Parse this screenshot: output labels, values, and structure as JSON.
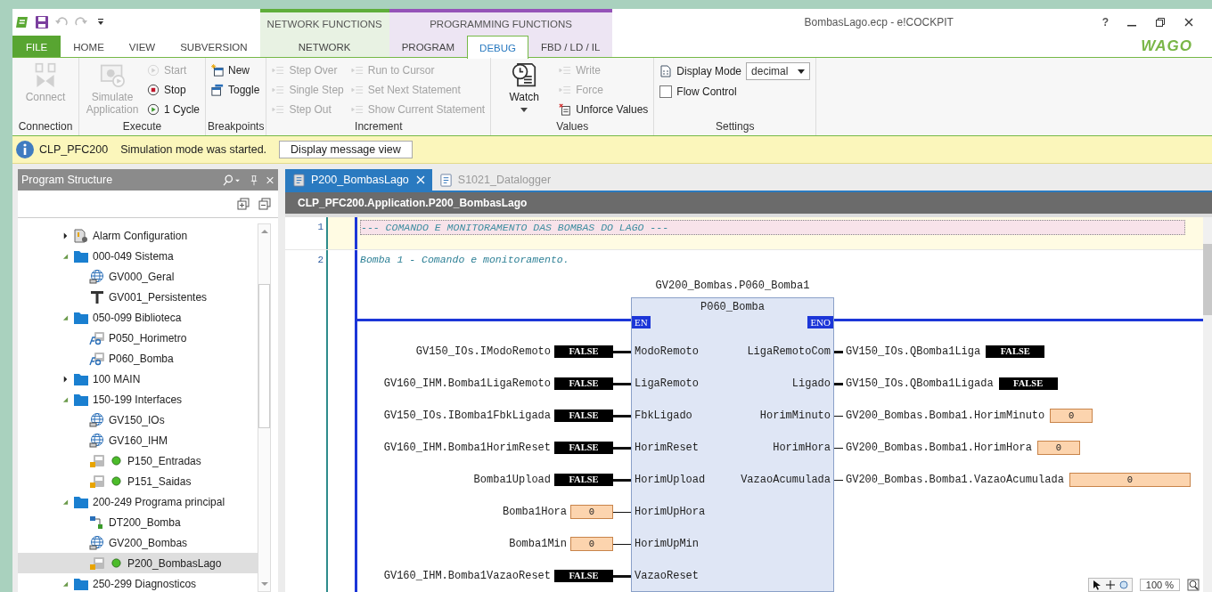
{
  "app": {
    "title": "BombasLago.ecp - e!COCKPIT",
    "help": "?",
    "logo": "WAGO"
  },
  "tabs": [
    {
      "label": "FILE",
      "kind": "file",
      "selected": false
    },
    {
      "label": "HOME",
      "kind": "tab",
      "selected": false
    },
    {
      "label": "VIEW",
      "kind": "tab",
      "selected": false
    },
    {
      "label": "SUBVERSION",
      "kind": "tab",
      "selected": false
    }
  ],
  "context_groups": [
    {
      "label": "NETWORK FUNCTIONS",
      "kind": "network",
      "tabs": [
        {
          "label": "NETWORK",
          "selected": false
        }
      ]
    },
    {
      "label": "PROGRAMMING FUNCTIONS",
      "kind": "programming",
      "tabs": [
        {
          "label": "PROGRAM",
          "selected": false
        },
        {
          "label": "DEBUG",
          "selected": true
        },
        {
          "label": "FBD / LD / IL",
          "selected": false
        }
      ]
    }
  ],
  "ribbon": [
    {
      "label": "Connection",
      "columns": [
        {
          "kind": "large",
          "items": [
            {
              "label": "Connect",
              "kind": "connect",
              "disabled": true
            }
          ]
        }
      ]
    },
    {
      "label": "Execute",
      "columns": [
        {
          "kind": "large",
          "items": [
            {
              "label": "Simulate Application",
              "kind": "simulate",
              "disabled": true
            }
          ]
        },
        {
          "kind": "small",
          "items": [
            {
              "label": "Start",
              "kind": "start",
              "disabled": true
            },
            {
              "label": "Stop",
              "kind": "stop",
              "disabled": false
            },
            {
              "label": "1 Cycle",
              "kind": "cycle",
              "disabled": false
            }
          ]
        }
      ]
    },
    {
      "label": "Breakpoints",
      "columns": [
        {
          "kind": "small",
          "items": [
            {
              "label": "New",
              "kind": "new",
              "disabled": false
            },
            {
              "label": "Toggle",
              "kind": "toggle",
              "disabled": false
            }
          ]
        }
      ]
    },
    {
      "label": "Increment",
      "columns": [
        {
          "kind": "small",
          "items": [
            {
              "label": "Step Over",
              "kind": "step",
              "disabled": true
            },
            {
              "label": "Single Step",
              "kind": "step",
              "disabled": true
            },
            {
              "label": "Step Out",
              "kind": "step",
              "disabled": true
            }
          ]
        },
        {
          "kind": "small",
          "items": [
            {
              "label": "Run to Cursor",
              "kind": "cursor",
              "disabled": true
            },
            {
              "label": "Set Next Statement",
              "kind": "next",
              "disabled": true
            },
            {
              "label": "Show Current Statement",
              "kind": "arrow",
              "disabled": true
            }
          ]
        }
      ]
    },
    {
      "label": "Values",
      "columns": [
        {
          "kind": "large",
          "items": [
            {
              "label": "Watch",
              "kind": "watch",
              "disabled": false,
              "dropdown": true
            }
          ]
        },
        {
          "kind": "small",
          "items": [
            {
              "label": "Write",
              "kind": "write",
              "disabled": true
            },
            {
              "label": "Force",
              "kind": "force",
              "disabled": true
            },
            {
              "label": "Unforce Values",
              "kind": "unforce",
              "disabled": false
            }
          ]
        }
      ]
    },
    {
      "label": "Settings",
      "columns": [
        {
          "kind": "small",
          "items": [
            {
              "label": "Display Mode",
              "kind": "select",
              "value": "decimal"
            },
            {
              "label": "Flow Control",
              "kind": "checkbox",
              "checked": false
            }
          ]
        }
      ]
    }
  ],
  "message": {
    "source": "CLP_PFC200",
    "text": "Simulation mode was started.",
    "button": "Display message view"
  },
  "program_structure": {
    "title": "Program Structure",
    "tree": [
      {
        "label": "Alarm Configuration",
        "kind": "alarm",
        "expanded": false,
        "selected": false
      },
      {
        "label": "000-049 Sistema",
        "kind": "folder",
        "expanded": true,
        "selected": false,
        "children": [
          {
            "label": "GV000_Geral",
            "kind": "gvl",
            "selected": false
          },
          {
            "label": "GV001_Persistentes",
            "kind": "persistent",
            "selected": false
          }
        ]
      },
      {
        "label": "050-099 Biblioteca",
        "kind": "folder",
        "expanded": true,
        "selected": false,
        "children": [
          {
            "label": "P050_Horimetro",
            "kind": "fb",
            "selected": false
          },
          {
            "label": "P060_Bomba",
            "kind": "fb",
            "selected": false
          }
        ]
      },
      {
        "label": "100 MAIN",
        "kind": "folder",
        "expanded": false,
        "selected": false
      },
      {
        "label": "150-199 Interfaces",
        "kind": "folder",
        "expanded": true,
        "selected": false,
        "children": [
          {
            "label": "GV150_IOs",
            "kind": "gvl",
            "selected": false
          },
          {
            "label": "GV160_IHM",
            "kind": "gvl",
            "selected": false
          },
          {
            "label": "P150_Entradas",
            "kind": "prg",
            "running": true,
            "selected": false
          },
          {
            "label": "P151_Saidas",
            "kind": "prg",
            "running": true,
            "selected": false
          }
        ]
      },
      {
        "label": "200-249 Programa principal",
        "kind": "folder",
        "expanded": true,
        "selected": false,
        "children": [
          {
            "label": "DT200_Bomba",
            "kind": "dut",
            "selected": false
          },
          {
            "label": "GV200_Bombas",
            "kind": "gvl",
            "selected": false
          },
          {
            "label": "P200_BombasLago",
            "kind": "prg",
            "running": true,
            "selected": true
          }
        ]
      },
      {
        "label": "250-299 Diagnosticos",
        "kind": "folder",
        "expanded": true,
        "selected": false
      }
    ]
  },
  "editor": {
    "tabs": [
      {
        "label": "P200_BombasLago",
        "selected": true
      },
      {
        "label": "S1021_Datalogger",
        "selected": false
      }
    ],
    "path": "CLP_PFC200.Application.P200_BombasLago",
    "networks": [
      {
        "number": "1",
        "kind": "title",
        "comment": "--- COMANDO E MONITORAMENTO DAS BOMBAS DO LAGO ---"
      },
      {
        "number": "2",
        "kind": "block",
        "comment": "Bomba 1 - Comando e monitoramento.",
        "block": {
          "instance": "GV200_Bombas.P060_Bomba1",
          "type": "P060_Bomba",
          "en": "EN",
          "eno": "ENO",
          "inputs": [
            {
              "variable": "GV150_IOs.IModoRemoto",
              "value": "FALSE",
              "kind": "bool",
              "pin": "ModoRemoto"
            },
            {
              "variable": "GV160_IHM.Bomba1LigaRemoto",
              "value": "FALSE",
              "kind": "bool",
              "pin": "LigaRemoto"
            },
            {
              "variable": "GV150_IOs.IBomba1FbkLigada",
              "value": "FALSE",
              "kind": "bool",
              "pin": "FbkLigado"
            },
            {
              "variable": "GV160_IHM.Bomba1HorimReset",
              "value": "FALSE",
              "kind": "bool",
              "pin": "HorimReset"
            },
            {
              "variable": "Bomba1Upload",
              "value": "FALSE",
              "kind": "bool",
              "pin": "HorimUpload"
            },
            {
              "variable": "Bomba1Hora",
              "value": "0",
              "kind": "number",
              "pin": "HorimUpHora"
            },
            {
              "variable": "Bomba1Min",
              "value": "0",
              "kind": "number",
              "pin": "HorimUpMin"
            },
            {
              "variable": "GV160_IHM.Bomba1VazaoReset",
              "value": "FALSE",
              "kind": "bool",
              "pin": "VazaoReset"
            }
          ],
          "outputs": [
            {
              "pin": "LigaRemotoCom",
              "variable": "GV150_IOs.QBomba1Liga",
              "value": "FALSE",
              "kind": "bool"
            },
            {
              "pin": "Ligado",
              "variable": "GV150_IOs.QBomba1Ligada",
              "value": "FALSE",
              "kind": "bool"
            },
            {
              "pin": "HorimMinuto",
              "variable": "GV200_Bombas.Bomba1.HorimMinuto",
              "value": "0",
              "kind": "number"
            },
            {
              "pin": "HorimHora",
              "variable": "GV200_Bombas.Bomba1.HorimHora",
              "value": "0",
              "kind": "number"
            },
            {
              "pin": "VazaoAcumulada",
              "variable": "GV200_Bombas.Bomba1.VazaoAcumulada",
              "value": "0",
              "kind": "number"
            }
          ]
        }
      }
    ],
    "zoom": "100 %"
  }
}
